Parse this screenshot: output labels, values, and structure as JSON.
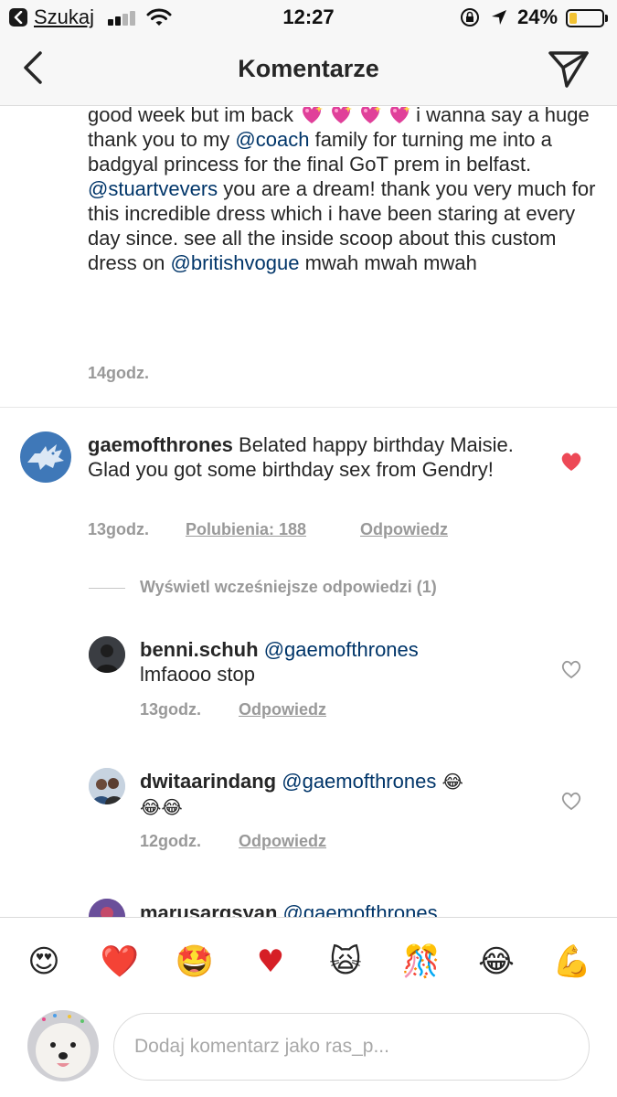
{
  "status_bar": {
    "back_app_label": "Szukaj",
    "time": "12:27",
    "battery_percent": "24%",
    "battery_level": 0.24,
    "signal_bars": 4,
    "signal_bars_active": 2
  },
  "header": {
    "title": "Komentarze"
  },
  "caption": {
    "text_line1_pre": "good week but im back ",
    "text_line1_post": "i",
    "text_part2": "wanna say a huge thank you to my ",
    "mention1": "@coach",
    "text_part3": " family for turning me into a badgyal princess for the final GoT prem in belfast. ",
    "mention2": "@stuartvevers",
    "text_part4": " you are a dream! thank you very much for this incredible dress which i have been staring at every day since. see all the inside scoop about this custom dress on ",
    "mention3": "@britishvogue",
    "text_part5": " mwah mwah mwah",
    "time": "14godz."
  },
  "comments": [
    {
      "username": "gaemofthrones",
      "text": " Belated happy birthday Maisie. Glad you got some birthday sex from Gendry!",
      "time": "13godz.",
      "likes": "Polubienia: 188",
      "reply": "Odpowiedz",
      "liked": true
    }
  ],
  "view_earlier": "Wyświetl wcześniejsze odpowiedzi (1)",
  "replies": [
    {
      "username": "benni.schuh",
      "mention": "@gaemofthrones",
      "text": "lmfaooo stop",
      "time": "13godz.",
      "reply": "Odpowiedz"
    },
    {
      "username": "dwitaarindang",
      "mention": "@gaemofthrones",
      "text": "",
      "time": "12godz.",
      "reply": "Odpowiedz"
    },
    {
      "username": "marusargsyan",
      "mention": "@gaemofthrones"
    }
  ],
  "emoji_bar": [
    "😍",
    "❤️",
    "🤩",
    "♥",
    "🙀",
    "🎊",
    "😂",
    "💪"
  ],
  "composer": {
    "placeholder": "Dodaj komentarz jako ras_p..."
  },
  "colors": {
    "mention": "#003569",
    "like_heart": "#ed4956",
    "muted": "#999999",
    "bar_bg": "#f7f7f7"
  }
}
